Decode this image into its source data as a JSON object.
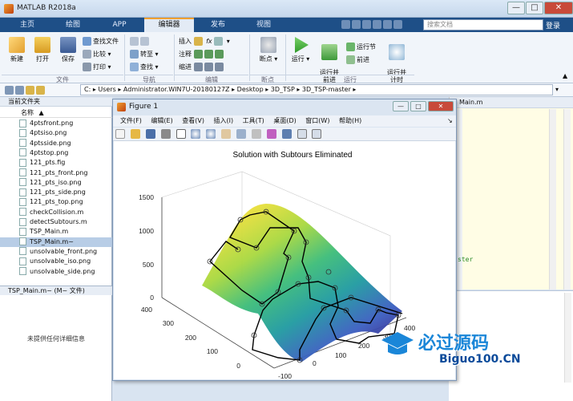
{
  "app": {
    "title": "MATLAB R2018a",
    "window_buttons": [
      "—",
      "□",
      "✕"
    ]
  },
  "tabs": [
    "主页",
    "绘图",
    "APP",
    "编辑器",
    "发布",
    "视图"
  ],
  "search": {
    "placeholder": "搜索文档"
  },
  "login": "登录",
  "ribbon": {
    "new": "新建",
    "open": "打开",
    "save": "保存",
    "find_files": "查找文件",
    "compare": "比较",
    "print": "打印",
    "goto": "转至",
    "find": "查找",
    "insert": "插入",
    "comment": "注释",
    "indent": "缩进",
    "fx": "fx",
    "breakpoints": "断点",
    "run": "运行",
    "run_advance": "运行并\n前进",
    "run_section": "运行节",
    "advance": "前进",
    "run_time": "运行并\n计时",
    "sections": [
      "文件",
      "导航",
      "编辑",
      "断点",
      "运行"
    ]
  },
  "address": {
    "path": [
      "C:",
      "Users",
      "Administrator.WIN7U-20180127Z",
      "Desktop",
      "3D_TSP",
      "3D_TSP-master"
    ]
  },
  "left_panel": {
    "header": "当前文件夹",
    "column": "名称",
    "sort": "▲",
    "files": [
      "4ptsfront.png",
      "4ptsiso.png",
      "4ptsside.png",
      "4ptstop.png",
      "121_pts.fig",
      "121_pts_front.png",
      "121_pts_iso.png",
      "121_pts_side.png",
      "121_pts_top.png",
      "checkCollision.m",
      "detectSubtours.m",
      "TSP_Main.m",
      "TSP_Main.m~",
      "unsolvable_front.png",
      "unsolvable_iso.png",
      "unsolvable_side.png"
    ],
    "selected_index": 12,
    "detail_header": "TSP_Main.m~  (M~ 文件)",
    "no_detail": "未提供任何详细信息"
  },
  "editor": {
    "tab_suffix": "Main.m",
    "fragment": "ster"
  },
  "figure": {
    "title": "Figure 1",
    "menus": [
      "文件(F)",
      "编辑(E)",
      "查看(V)",
      "插入(I)",
      "工具(T)",
      "桌面(D)",
      "窗口(W)",
      "帮助(H)"
    ],
    "plot_title": "Solution with Subtours Eliminated",
    "z_ticks": [
      "1500",
      "1000",
      "500",
      "0"
    ],
    "y_ticks": [
      "400",
      "300",
      "200",
      "100",
      "0"
    ],
    "x_ticks": [
      "-100",
      "0",
      "100",
      "200",
      "300",
      "400"
    ]
  },
  "watermark": {
    "cn": "必过源码",
    "en": "Biguo100.CN"
  },
  "colors": {
    "ribbon_tab": "#1e4f87",
    "accent": "#f0a030",
    "surface_high": "#f6e03a",
    "surface_low": "#3a3ea0"
  }
}
